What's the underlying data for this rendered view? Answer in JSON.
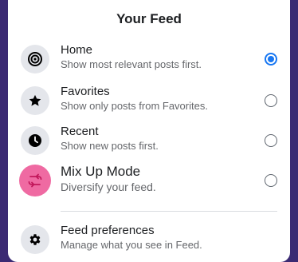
{
  "feed": {
    "title": "Your Feed",
    "options": [
      {
        "label": "Home",
        "description": "Show most relevant posts first.",
        "icon": "target-icon",
        "selected": true
      },
      {
        "label": "Favorites",
        "description": "Show only posts from Favorites.",
        "icon": "star-icon",
        "selected": false
      },
      {
        "label": "Recent",
        "description": "Show new posts first.",
        "icon": "clock-icon",
        "selected": false
      },
      {
        "label": "Mix Up Mode",
        "description": "Diversify your feed.",
        "icon": "shuffle-icon",
        "selected": false
      }
    ],
    "preferences": {
      "label": "Feed preferences",
      "description": "Manage what you see in Feed.",
      "icon": "gear-icon"
    }
  },
  "colors": {
    "accent": "#1877f2",
    "mix_icon_bg": "#ef6aa2",
    "backdrop": "#3b2a73"
  }
}
